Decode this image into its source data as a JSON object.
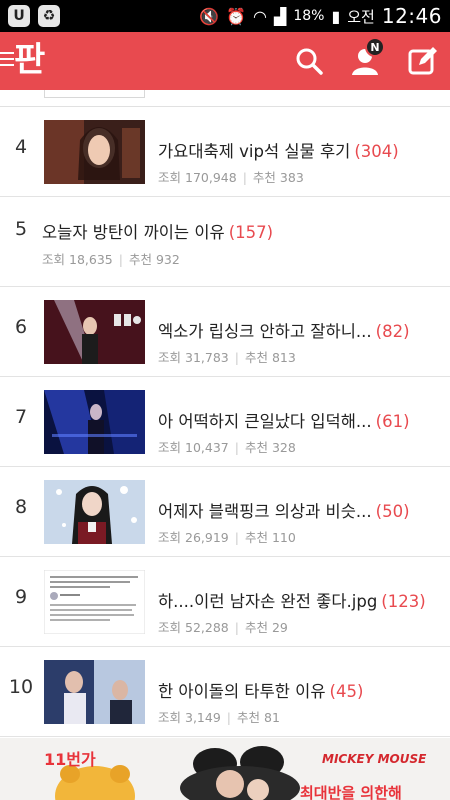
{
  "status_bar": {
    "battery": "18%",
    "ampm": "오전",
    "time": "12:46"
  },
  "header": {
    "logo": "판",
    "notification_badge": "N",
    "icons": [
      "menu-icon",
      "search-icon",
      "profile-icon",
      "compose-icon"
    ]
  },
  "list": {
    "items": [
      {
        "rank": "4",
        "title": "가요대축제 vip석 실물 후기",
        "count": "(304)",
        "views_label": "조회",
        "views": "170,948",
        "likes_label": "추천",
        "likes": "383"
      },
      {
        "rank": "5",
        "title": "오늘자 방탄이 까이는 이유",
        "count": "(157)",
        "views_label": "조회",
        "views": "18,635",
        "likes_label": "추천",
        "likes": "932"
      },
      {
        "rank": "6",
        "title": "엑소가 립싱크 안하고 잘하니...",
        "count": "(82)",
        "views_label": "조회",
        "views": "31,783",
        "likes_label": "추천",
        "likes": "813"
      },
      {
        "rank": "7",
        "title": "아 어떡하지 큰일났다 입덕해...",
        "count": "(61)",
        "views_label": "조회",
        "views": "10,437",
        "likes_label": "추천",
        "likes": "328"
      },
      {
        "rank": "8",
        "title": "어제자 블랙핑크 의상과 비슷...",
        "count": "(50)",
        "views_label": "조회",
        "views": "26,919",
        "likes_label": "추천",
        "likes": "110"
      },
      {
        "rank": "9",
        "title": "하....이런 남자손 완전 좋다.jpg",
        "count": "(123)",
        "views_label": "조회",
        "views": "52,288",
        "likes_label": "추천",
        "likes": "29"
      },
      {
        "rank": "10",
        "title": "한 아이돌의 타투한 이유",
        "count": "(45)",
        "views_label": "조회",
        "views": "3,149",
        "likes_label": "추천",
        "likes": "81"
      }
    ]
  },
  "ad": {
    "brand": "11번가",
    "character": "MICKEY MOUSE",
    "tagline": "최대반을 의한해"
  },
  "colors": {
    "accent": "#e84a4f",
    "text": "#222222",
    "meta": "#999999"
  }
}
